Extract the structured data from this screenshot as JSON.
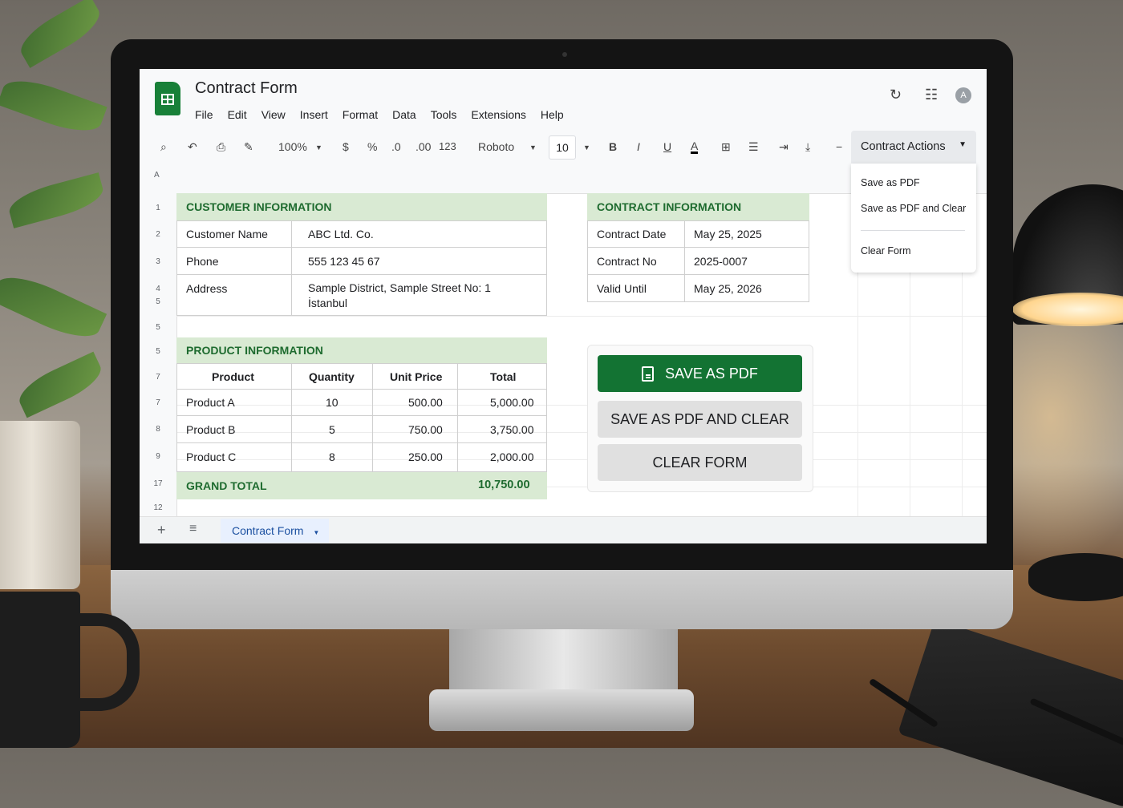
{
  "app": {
    "title": "Contract Form"
  },
  "menu": [
    "File",
    "Edit",
    "View",
    "Insert",
    "Format",
    "Data",
    "Tools",
    "Extensions",
    "Help"
  ],
  "toolbar": {
    "zoom": "100%",
    "currency": "$",
    "percent": "%",
    "dec_less": ".0",
    "dec_more": ".00",
    "format_more": "123",
    "font": "Roboto",
    "font_size": "10",
    "bold": "B",
    "italic": "I",
    "underline": "U",
    "text_color": "A"
  },
  "actions": {
    "label": "Contract Actions",
    "items": [
      "Save as PDF",
      "Save as PDF and Clear",
      "Clear Form"
    ]
  },
  "avatar": {
    "letter": "A"
  },
  "col_header_first": "A",
  "row_numbers": [
    "1",
    "2",
    "3",
    "4",
    "5",
    "5",
    "5",
    "7",
    "7",
    "8",
    "9",
    "17",
    "12"
  ],
  "customer": {
    "header": "CUSTOMER INFORMATION",
    "rows": [
      {
        "label": "Customer Name",
        "value": "ABC Ltd. Co."
      },
      {
        "label": "Phone",
        "value": "555 123 45 67"
      },
      {
        "label": "Address",
        "value": "Sample District, Sample Street No: 1",
        "value2": "İstanbul"
      }
    ]
  },
  "contract": {
    "header": "CONTRACT INFORMATION",
    "rows": [
      {
        "label": "Contract Date",
        "value": "May 25, 2025"
      },
      {
        "label": "Contract No",
        "value": "2025-0007"
      },
      {
        "label": "Valid Until",
        "value": "May 25, 2026"
      }
    ]
  },
  "product": {
    "header": "PRODUCT INFORMATION",
    "columns": [
      "Product",
      "Quantity",
      "Unit Price",
      "Total"
    ],
    "rows": [
      [
        "Product A",
        "10",
        "500.00",
        "5,000.00"
      ],
      [
        "Product B",
        "5",
        "750.00",
        "3,750.00"
      ],
      [
        "Product C",
        "8",
        "250.00",
        "2,000.00"
      ]
    ],
    "grand_total_label": "GRAND TOTAL",
    "grand_total": "10,750.00"
  },
  "buttons": {
    "save_pdf": "SAVE AS PDF",
    "save_clear": "SAVE AS PDF AND CLEAR",
    "clear": "CLEAR FORM"
  },
  "sheet": {
    "tab": "Contract Form"
  }
}
